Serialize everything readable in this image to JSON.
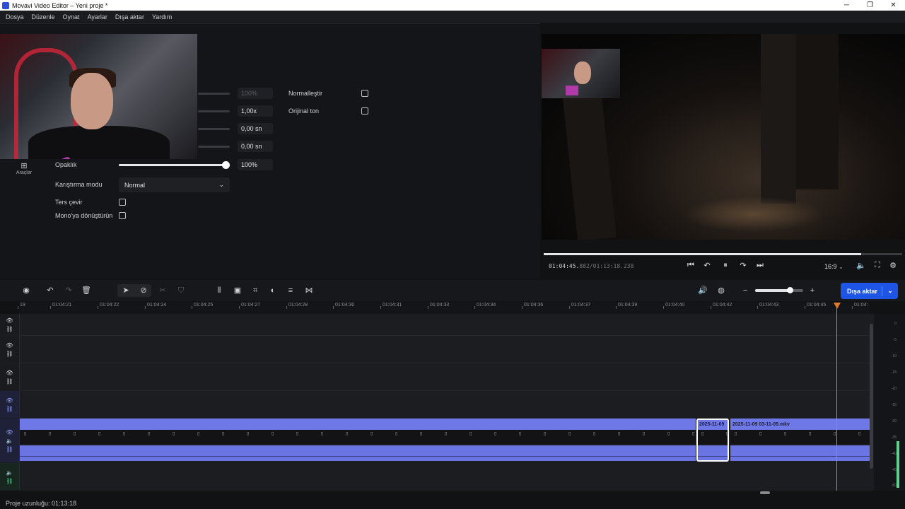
{
  "window": {
    "title": "Movavi Video Editor – Yeni proje *",
    "controls": [
      "─",
      "❐",
      "✕"
    ]
  },
  "menu": [
    "Dosya",
    "Düzenle",
    "Oynat",
    "Ayarlar",
    "Dışa aktar",
    "Yardım"
  ],
  "side": {
    "tools_label": "Araçlar",
    "tools_icon": "grid-icon"
  },
  "properties": {
    "rows": [
      {
        "label": "",
        "value": "100%",
        "dim": true
      },
      {
        "label": "",
        "value": "1,00x"
      },
      {
        "label": "",
        "value": "0,00 sn"
      },
      {
        "label": "",
        "value": "0,00 sn"
      },
      {
        "label": "Opaklık",
        "value": "100%",
        "level": 1.0
      }
    ],
    "blend_label": "Karıştırma modu",
    "blend_value": "Normal",
    "invert_label": "Ters çevir",
    "mono_label": "Mono'ya dönüştürün",
    "normalize_label": "Normalleştir",
    "original_tone_label": "Orijinal ton"
  },
  "player": {
    "timecode_main": "01:04:45.",
    "timecode_rest": "882/01:13:18.238",
    "progress": 0.885,
    "aspect_ratio": "16:9"
  },
  "toolbar": {
    "export_label": "Dışa aktar",
    "zoom_level": 0.72
  },
  "ruler_ticks": [
    "19",
    "01:04:21",
    "01:04:22",
    "01:04:24",
    "01:04:25",
    "01:04:27",
    "01:04:28",
    "01:04:30",
    "01:04:31",
    "01:04:33",
    "01:04:34",
    "01:04:36",
    "01:04:37",
    "01:04:39",
    "01:04:40",
    "01:04:42",
    "01:04:43",
    "01:04:45",
    "01:04:"
  ],
  "clips": {
    "short_label": "2025-11-09",
    "long_label": "2025-11-09 03-11-09.mkv"
  },
  "meter_scale": [
    "0",
    "-5",
    "-10",
    "-15",
    "-20",
    "-25",
    "-30",
    "-35",
    "-40",
    "-45",
    "-50"
  ],
  "status": {
    "duration": "Proje uzunluğu: 01:13:18"
  }
}
